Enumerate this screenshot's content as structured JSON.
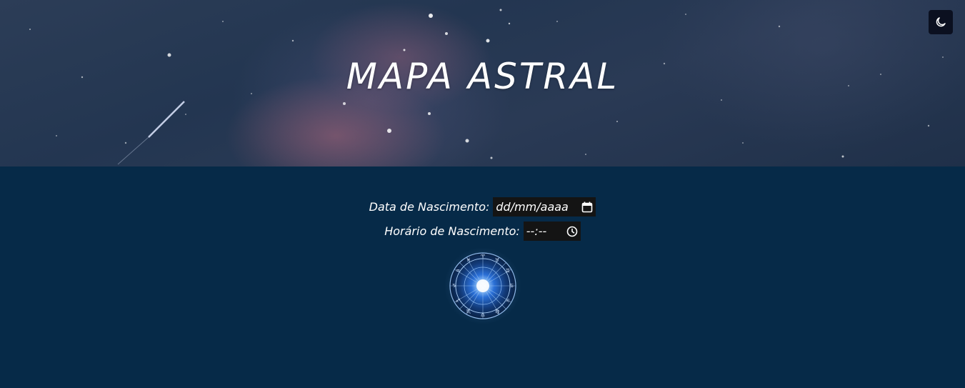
{
  "header": {
    "title": "MAPA ASTRAL",
    "theme_toggle_icon": "moon-icon"
  },
  "form": {
    "birth_date": {
      "label": "Data de Nascimento:",
      "placeholder": "dd/mm/aaaa",
      "icon": "calendar-icon"
    },
    "birth_time": {
      "label": "Horário de Nascimento:",
      "placeholder": "--:--",
      "icon": "clock-icon"
    }
  },
  "zodiac_wheel": {
    "icon": "zodiac-wheel-icon"
  },
  "colors": {
    "page_background": "#062a48",
    "input_background": "#141414",
    "text": "#ffffff",
    "toggle_background": "#0b1020"
  }
}
